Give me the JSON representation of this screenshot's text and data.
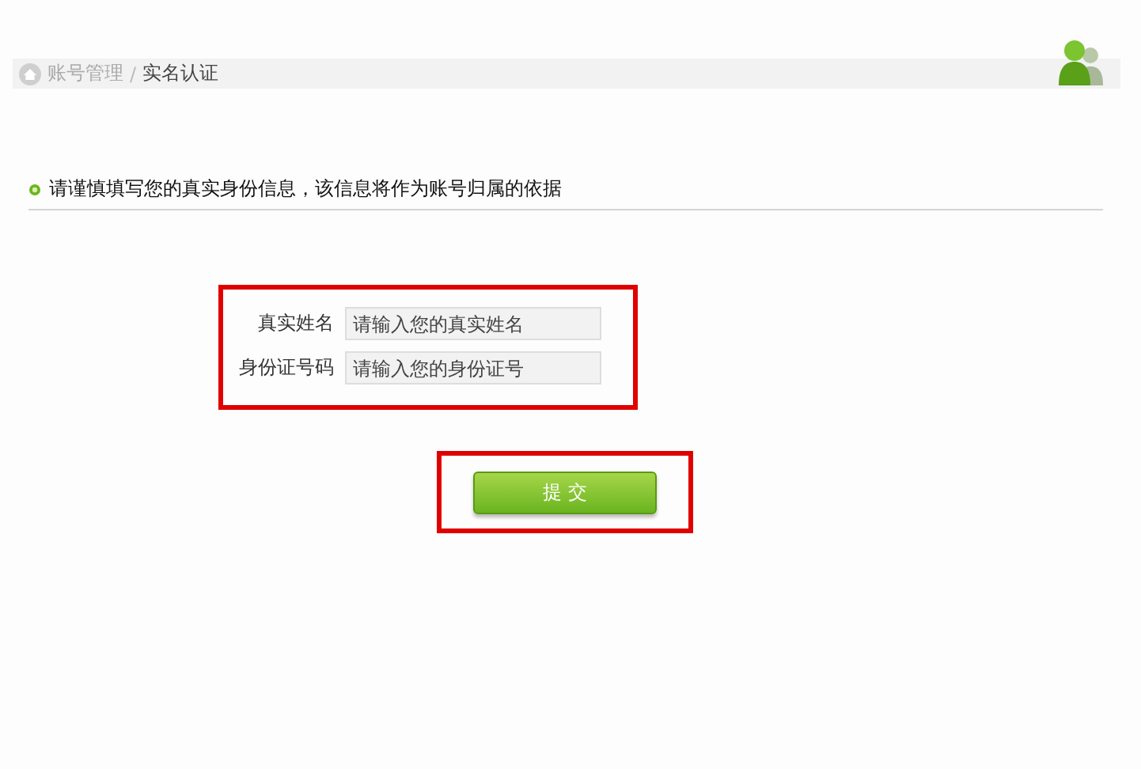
{
  "breadcrumb": {
    "items": [
      {
        "label": "账号管理",
        "current": false
      },
      {
        "label": "实名认证",
        "current": true
      }
    ],
    "separator": "/"
  },
  "notice": "请谨慎填写您的真实身份信息，该信息将作为账号归属的依据",
  "form": {
    "highlighted": true,
    "fields": [
      {
        "label": "真实姓名",
        "placeholder": "请输入您的真实姓名"
      },
      {
        "label": "身份证号码",
        "placeholder": "请输入您的身份证号"
      }
    ]
  },
  "submit": {
    "label": "提 交",
    "highlighted": true
  }
}
